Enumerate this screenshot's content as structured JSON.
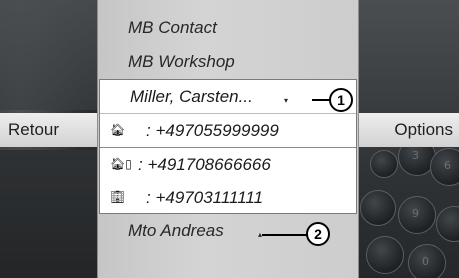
{
  "left_softkey": "Retour",
  "right_softkey": "Options",
  "menu": {
    "item_contact": "MB Contact",
    "item_workshop": "MB Workshop",
    "selected_name": "Miller, Carsten...",
    "numbers": [
      {
        "icon": "home-icon",
        "label": ": +497055999999"
      },
      {
        "icon": "home-mobile-icon",
        "label": ": +491708666666"
      },
      {
        "icon": "office-icon",
        "label": ": +49703111111"
      }
    ],
    "next_item": "Mto Andreas"
  },
  "callouts": [
    "1",
    "2"
  ],
  "knob_digits": [
    "3",
    "6",
    "9",
    "0"
  ]
}
